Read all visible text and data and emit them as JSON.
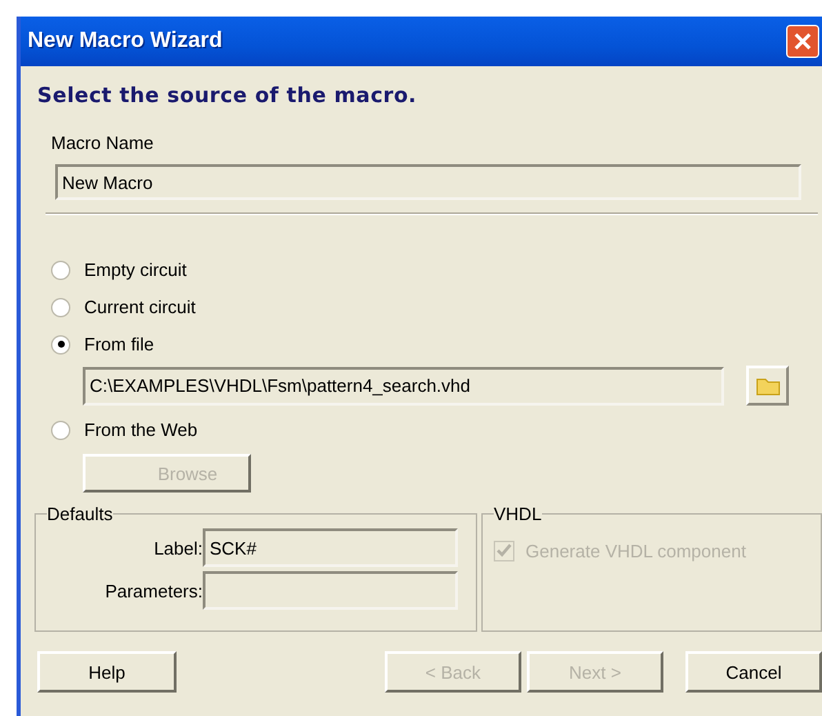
{
  "window": {
    "title": "New Macro Wizard"
  },
  "heading": "Select the source of the macro.",
  "macro_name": {
    "label": "Macro Name",
    "value": "New Macro"
  },
  "sources": [
    {
      "label": "Empty circuit",
      "selected": false
    },
    {
      "label": "Current circuit",
      "selected": false
    },
    {
      "label": "From file",
      "selected": true
    },
    {
      "label": "From the Web",
      "selected": false
    }
  ],
  "file_path": {
    "value": "C:\\EXAMPLES\\VHDL\\Fsm\\pattern4_search.vhd"
  },
  "browse_button": {
    "label": "Browse",
    "disabled": true
  },
  "defaults": {
    "title": "Defaults",
    "fields": [
      {
        "label": "Label:",
        "value": "SCK#"
      },
      {
        "label": "Parameters:"
      }
    ]
  },
  "vhdl": {
    "title": "VHDL",
    "option": {
      "label": "Generate VHDL component",
      "checked": true,
      "disabled": true
    }
  },
  "buttons": [
    {
      "label": "Help",
      "disabled": false,
      "kind": "left"
    },
    {
      "label": "< Back",
      "disabled": true,
      "kind": "nav"
    },
    {
      "label": "Next >",
      "disabled": true,
      "kind": "nav"
    },
    {
      "label": "Cancel",
      "disabled": false,
      "kind": "right"
    }
  ]
}
